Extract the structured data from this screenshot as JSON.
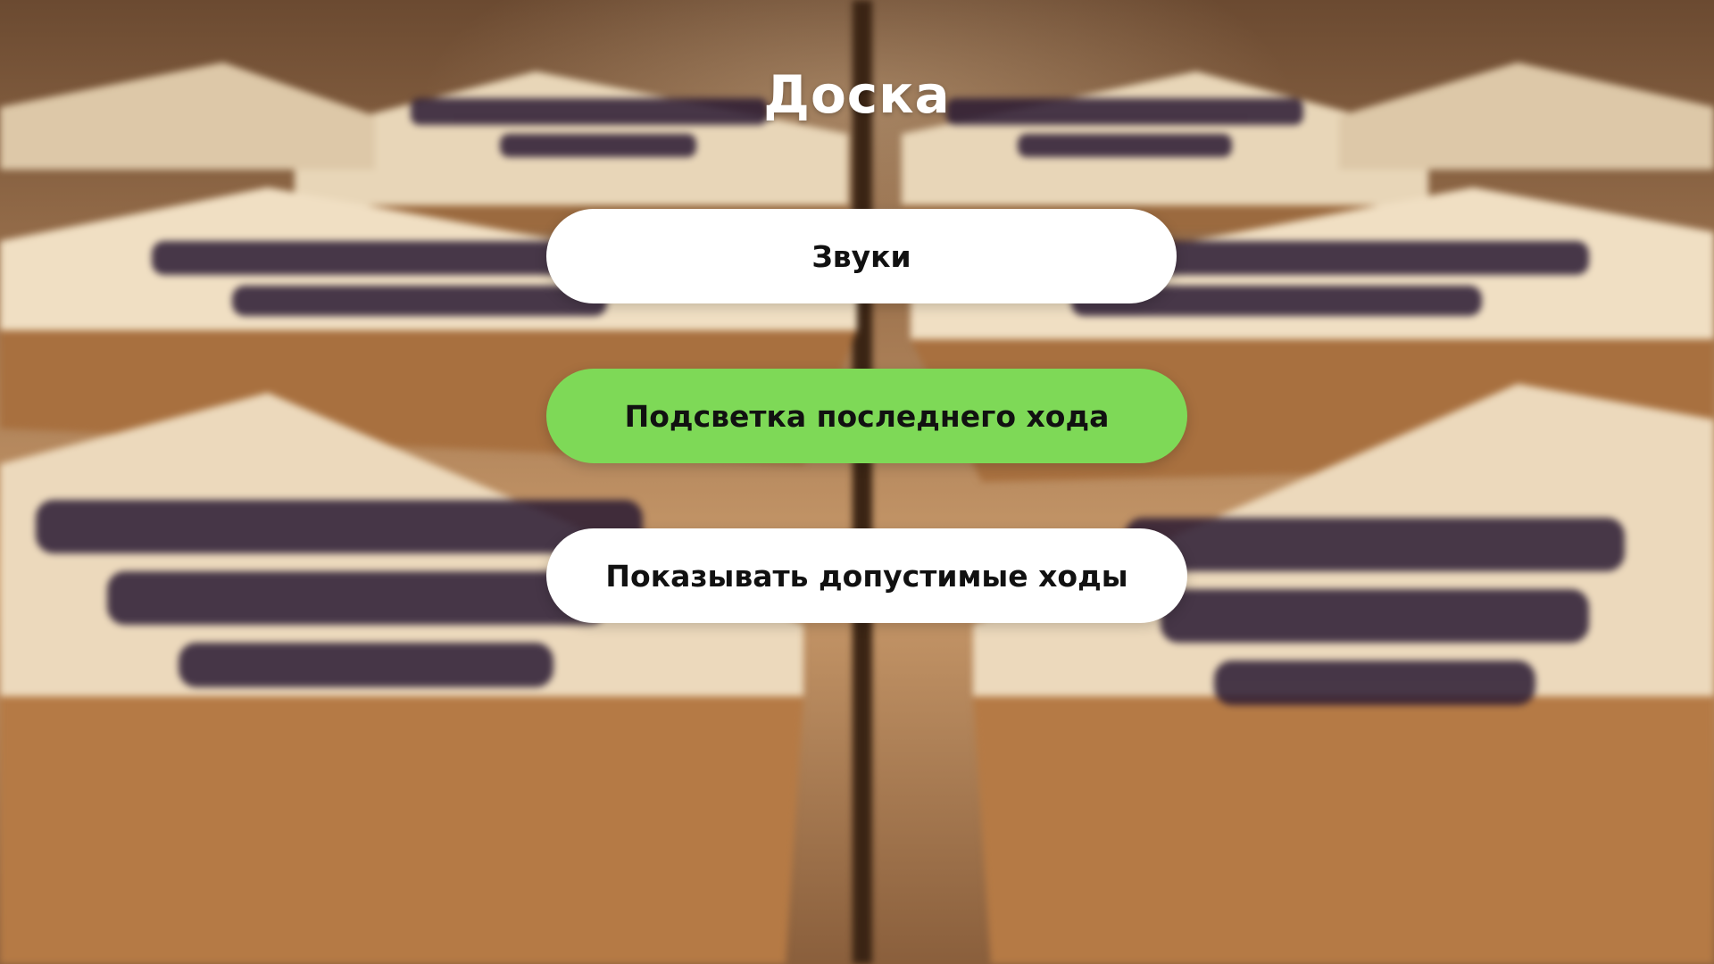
{
  "screen": {
    "title": "Доска"
  },
  "menu": {
    "items": [
      {
        "label": "Звуки",
        "selected": false
      },
      {
        "label": "Подсветка последнего хода",
        "selected": true
      },
      {
        "label": "Показывать допустимые ходы",
        "selected": false
      }
    ]
  },
  "colors": {
    "accent": "#7ed957",
    "button_bg": "#ffffff",
    "title_text": "#ffffff",
    "button_text": "#111111"
  },
  "background": {
    "description_icon": "shogi-pieces-photo"
  }
}
